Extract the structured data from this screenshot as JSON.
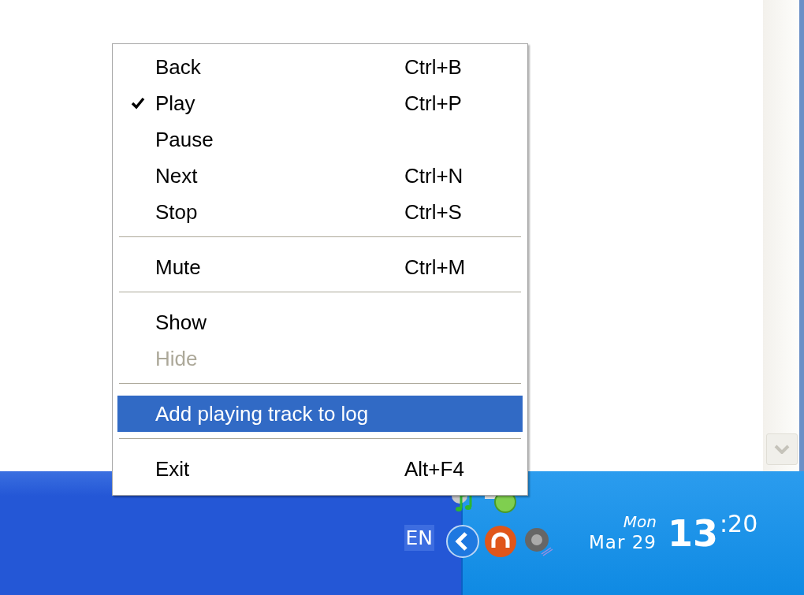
{
  "menu": {
    "items": [
      {
        "kind": "item",
        "label": "Back",
        "shortcut": "Ctrl+B",
        "checked": false,
        "disabled": false,
        "selected": false
      },
      {
        "kind": "item",
        "label": "Play",
        "shortcut": "Ctrl+P",
        "checked": true,
        "disabled": false,
        "selected": false
      },
      {
        "kind": "item",
        "label": "Pause",
        "checked": false,
        "disabled": false,
        "selected": false
      },
      {
        "kind": "item",
        "label": "Next",
        "shortcut": "Ctrl+N",
        "checked": false,
        "disabled": false,
        "selected": false
      },
      {
        "kind": "item",
        "label": "Stop",
        "shortcut": "Ctrl+S",
        "checked": false,
        "disabled": false,
        "selected": false
      },
      {
        "kind": "separator"
      },
      {
        "kind": "item",
        "label": "Mute",
        "shortcut": "Ctrl+M",
        "checked": false,
        "disabled": false,
        "selected": false
      },
      {
        "kind": "separator"
      },
      {
        "kind": "item",
        "label": "Show",
        "checked": false,
        "disabled": false,
        "selected": false
      },
      {
        "kind": "item",
        "label": "Hide",
        "checked": false,
        "disabled": true,
        "selected": false
      },
      {
        "kind": "separator"
      },
      {
        "kind": "item",
        "label": "Add playing track to log",
        "checked": false,
        "disabled": false,
        "selected": true
      },
      {
        "kind": "separator"
      },
      {
        "kind": "item",
        "label": "Exit",
        "shortcut": "Alt+F4",
        "checked": false,
        "disabled": false,
        "selected": false
      }
    ]
  },
  "taskbar": {
    "language": "EN",
    "clock": {
      "weekday": "Mon",
      "date": "Mar 29",
      "hours": "13",
      "minutes": ":20"
    }
  }
}
